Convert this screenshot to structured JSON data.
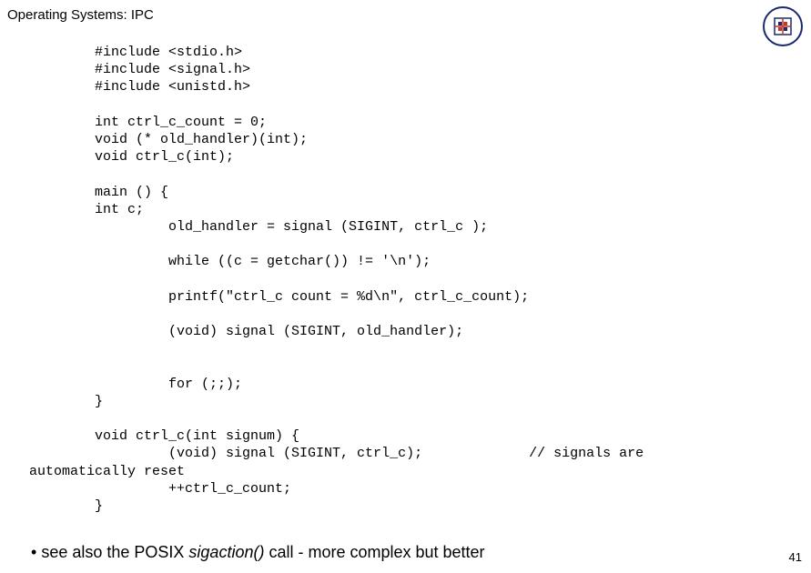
{
  "header": {
    "title": "Operating Systems: IPC"
  },
  "code": {
    "l1": "        #include <stdio.h>",
    "l2": "        #include <signal.h>",
    "l3": "        #include <unistd.h>",
    "l4": "",
    "l5": "        int ctrl_c_count = 0;",
    "l6": "        void (* old_handler)(int);",
    "l7": "        void ctrl_c(int);",
    "l8": "",
    "l9": "        main () {",
    "l10": "        int c;",
    "l11": "                 old_handler = signal (SIGINT, ctrl_c );",
    "l12": "",
    "l13": "                 while ((c = getchar()) != '\\n');",
    "l14": "",
    "l15": "                 printf(\"ctrl_c count = %d\\n\", ctrl_c_count);",
    "l16": "",
    "l17": "                 (void) signal (SIGINT, old_handler);",
    "l18": "",
    "l19": "",
    "l20": "                 for (;;);",
    "l21": "        }",
    "l22": "",
    "l23": "        void ctrl_c(int signum) {",
    "l24": "                 (void) signal (SIGINT, ctrl_c);             // signals are",
    "l25": "automatically reset",
    "l26": "                 ++ctrl_c_count;",
    "l27": "        }"
  },
  "footer": {
    "bullet": "•",
    "prefix": "see also the POSIX ",
    "italic": "sigaction()",
    "suffix": " call - more complex but better"
  },
  "page_number": "41"
}
